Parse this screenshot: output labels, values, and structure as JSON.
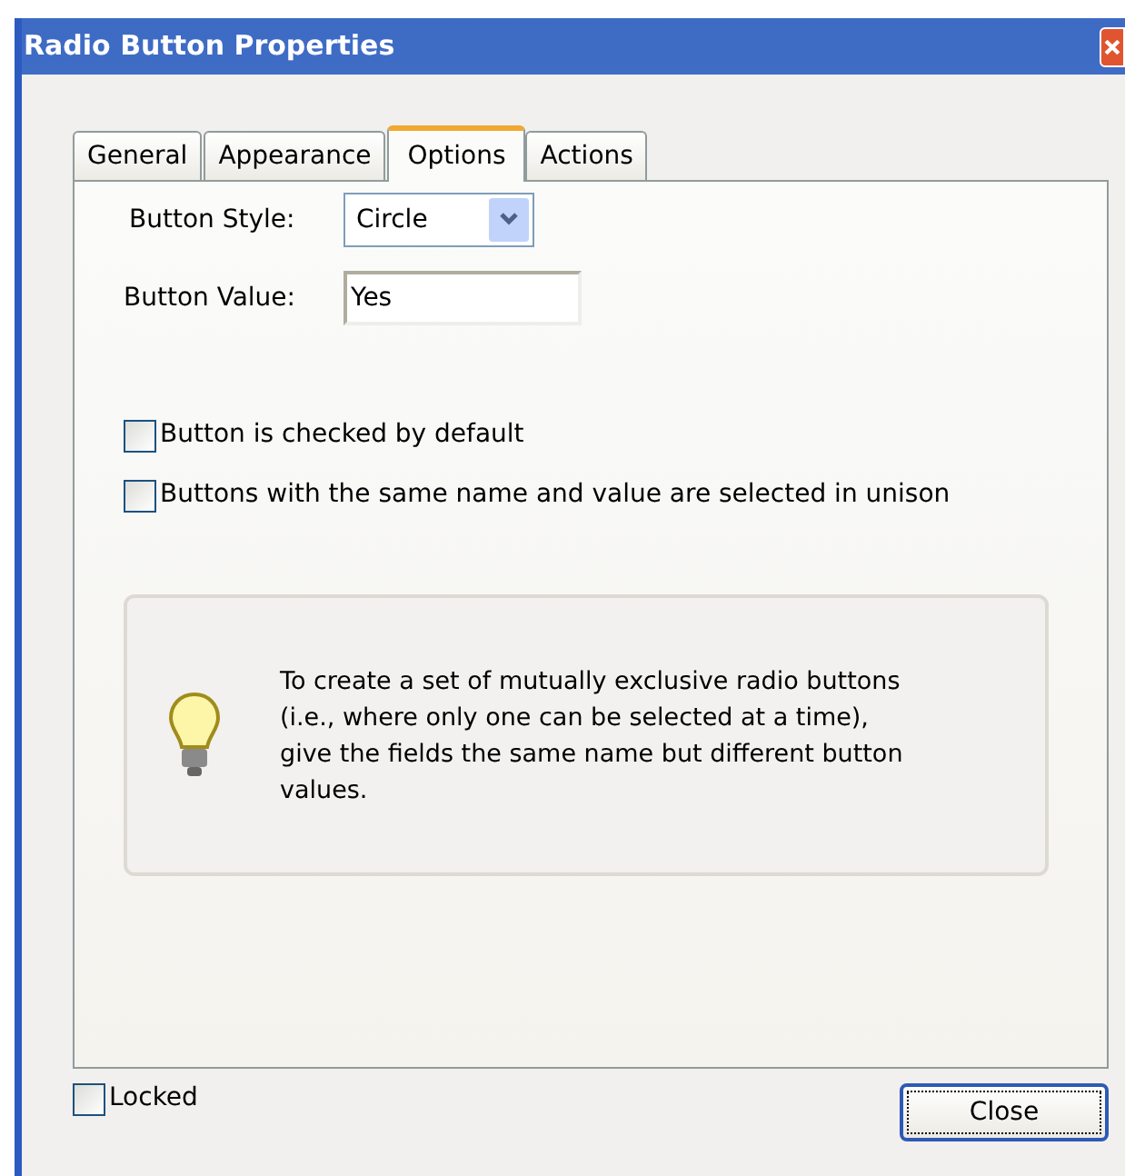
{
  "window": {
    "title": "Radio Button Properties"
  },
  "tabs": [
    {
      "label": "General",
      "selected": false
    },
    {
      "label": "Appearance",
      "selected": false
    },
    {
      "label": "Options",
      "selected": true
    },
    {
      "label": "Actions",
      "selected": false
    }
  ],
  "button_style": {
    "label": "Button Style:",
    "value": "Circle"
  },
  "button_value": {
    "label": "Button Value:",
    "value": "Yes"
  },
  "options": [
    {
      "label": "Button is checked by default",
      "checked": false
    },
    {
      "label": "Buttons with the same name and value are selected in unison",
      "checked": false
    }
  ],
  "hint": "To create a set of mutually exclusive radio buttons (i.e., where only one can be selected at a time), give the fields the same name but different button values.",
  "locked": {
    "label": "Locked",
    "checked": false
  },
  "close_button": "Close"
}
